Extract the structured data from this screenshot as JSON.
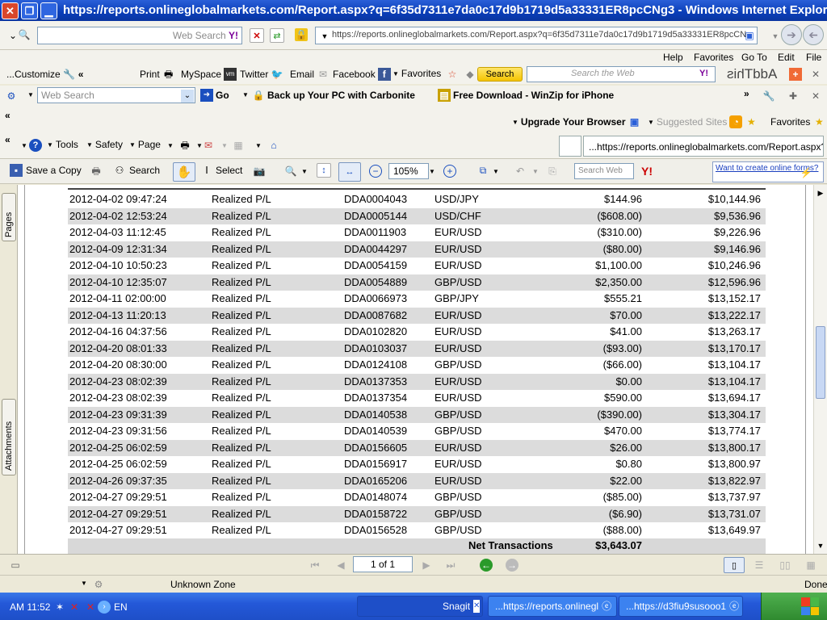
{
  "window": {
    "title": "https://reports.onlineglobalmarkets.com/Report.aspx?q=6f35d7311e7da0c17d9b1719d5a33331ER8pcCNg3 - Windows Internet Explorer"
  },
  "address_bar": {
    "search_placeholder": "Web Search",
    "url": "https://reports.onlineglobalmarkets.com/Report.aspx?q=6f35d7311e7da0c17d9b1719d5a33331ER8pcCN"
  },
  "menu": [
    "Help",
    "Favorites",
    "Go To",
    "Edit",
    "File"
  ],
  "addthis_toolbar": {
    "customize": "...Customize",
    "print": "Print",
    "myspace": "MySpace",
    "twitter": "Twitter",
    "email": "Email",
    "facebook": "Facebook",
    "favorites": "Favorites",
    "search_button": "Search",
    "search_placeholder": "Search the Web",
    "brand": "AddThis"
  },
  "yahoo_toolbar": {
    "search_placeholder": "Web Search",
    "go": "Go",
    "carbonite": "Back up Your PC with Carbonite",
    "winzip": "Free Download - WinZip for iPhone"
  },
  "favorites_bar": {
    "upgrade": "Upgrade Your Browser",
    "suggested": "Suggested Sites",
    "favorites": "Favorites"
  },
  "command_bar": {
    "tools": "Tools",
    "safety": "Safety",
    "page": "Page",
    "tab_title": "...https://reports.onlineglobalmarkets.com/Report.aspx?q"
  },
  "acrobat_toolbar": {
    "save_copy": "Save a Copy",
    "search": "Search",
    "select": "Select",
    "zoom": "105%",
    "search_placeholder": "Search Web",
    "forms_link": "Want to create online forms?"
  },
  "side_tabs": {
    "pages": "Pages",
    "attachments": "Attachments"
  },
  "report": {
    "rows": [
      [
        "2012-04-02 09:47:24",
        "Realized P/L",
        "DDA0004043",
        "USD/JPY",
        "$144.96",
        "$10,144.96"
      ],
      [
        "2012-04-02 12:53:24",
        "Realized P/L",
        "DDA0005144",
        "USD/CHF",
        "($608.00)",
        "$9,536.96"
      ],
      [
        "2012-04-03 11:12:45",
        "Realized P/L",
        "DDA0011903",
        "EUR/USD",
        "($310.00)",
        "$9,226.96"
      ],
      [
        "2012-04-09 12:31:34",
        "Realized P/L",
        "DDA0044297",
        "EUR/USD",
        "($80.00)",
        "$9,146.96"
      ],
      [
        "2012-04-10 10:50:23",
        "Realized P/L",
        "DDA0054159",
        "EUR/USD",
        "$1,100.00",
        "$10,246.96"
      ],
      [
        "2012-04-10 12:35:07",
        "Realized P/L",
        "DDA0054889",
        "GBP/USD",
        "$2,350.00",
        "$12,596.96"
      ],
      [
        "2012-04-11 02:00:00",
        "Realized P/L",
        "DDA0066973",
        "GBP/JPY",
        "$555.21",
        "$13,152.17"
      ],
      [
        "2012-04-13 11:20:13",
        "Realized P/L",
        "DDA0087682",
        "EUR/USD",
        "$70.00",
        "$13,222.17"
      ],
      [
        "2012-04-16 04:37:56",
        "Realized P/L",
        "DDA0102820",
        "EUR/USD",
        "$41.00",
        "$13,263.17"
      ],
      [
        "2012-04-20 08:01:33",
        "Realized P/L",
        "DDA0103037",
        "EUR/USD",
        "($93.00)",
        "$13,170.17"
      ],
      [
        "2012-04-20 08:30:00",
        "Realized P/L",
        "DDA0124108",
        "GBP/USD",
        "($66.00)",
        "$13,104.17"
      ],
      [
        "2012-04-23 08:02:39",
        "Realized P/L",
        "DDA0137353",
        "EUR/USD",
        "$0.00",
        "$13,104.17"
      ],
      [
        "2012-04-23 08:02:39",
        "Realized P/L",
        "DDA0137354",
        "EUR/USD",
        "$590.00",
        "$13,694.17"
      ],
      [
        "2012-04-23 09:31:39",
        "Realized P/L",
        "DDA0140538",
        "GBP/USD",
        "($390.00)",
        "$13,304.17"
      ],
      [
        "2012-04-23 09:31:56",
        "Realized P/L",
        "DDA0140539",
        "GBP/USD",
        "$470.00",
        "$13,774.17"
      ],
      [
        "2012-04-25 06:02:59",
        "Realized P/L",
        "DDA0156605",
        "EUR/USD",
        "$26.00",
        "$13,800.17"
      ],
      [
        "2012-04-25 06:02:59",
        "Realized P/L",
        "DDA0156917",
        "EUR/USD",
        "$0.80",
        "$13,800.97"
      ],
      [
        "2012-04-26 09:37:35",
        "Realized P/L",
        "DDA0165206",
        "EUR/USD",
        "$22.00",
        "$13,822.97"
      ],
      [
        "2012-04-27 09:29:51",
        "Realized P/L",
        "DDA0148074",
        "GBP/USD",
        "($85.00)",
        "$13,737.97"
      ],
      [
        "2012-04-27 09:29:51",
        "Realized P/L",
        "DDA0158722",
        "GBP/USD",
        "($6.90)",
        "$13,731.07"
      ],
      [
        "2012-04-27 09:29:51",
        "Realized P/L",
        "DDA0156528",
        "GBP/USD",
        "($88.00)",
        "$13,649.97"
      ]
    ],
    "total_label": "Net Transactions",
    "total_value": "$3,643.07"
  },
  "page_nav": {
    "page_indicator": "1 of 1"
  },
  "status_bar": {
    "zone": "Unknown Zone",
    "done": "Done"
  },
  "taskbar": {
    "clock": "AM 11:52",
    "lang": "EN",
    "items": [
      "Snagit",
      "...https://reports.onlinegl",
      "...https://d3fiu9susooo1"
    ]
  },
  "colors": {
    "title_blue": "#0a3eb8",
    "row_alt": "#dcdcdc",
    "taskbar_blue": "#2458d8"
  }
}
